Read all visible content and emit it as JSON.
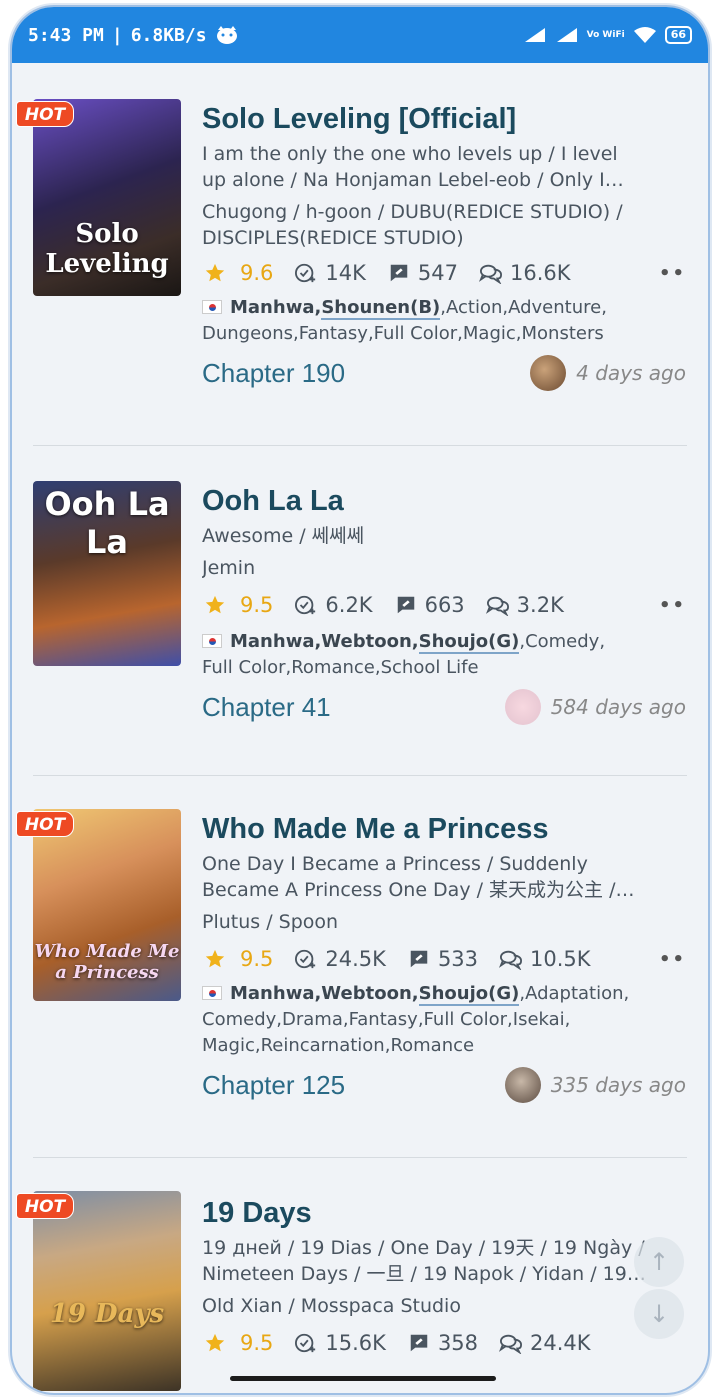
{
  "status_bar": {
    "time": "5:43 PM",
    "speed": "6.8KB/s",
    "wifi_label": "Vo WiFi",
    "battery": "66"
  },
  "comics": [
    {
      "hot": true,
      "hot_label": "HOT",
      "cover_text": "Solo Leveling",
      "title": "Solo Leveling [Official]",
      "alt_line1": "I am the only the one who levels up / I level",
      "alt_line2": "up alone / Na Honjaman Lebel-eob / Only I…",
      "authors_line1": "Chugong / h-goon / DUBU(REDICE STUDIO) /",
      "authors_line2": "DISCIPLES(REDICE STUDIO)",
      "rating": "9.6",
      "follows": "14K",
      "comments": "547",
      "reviews": "16.6K",
      "genre_primary": "Manhwa,",
      "genre_under": "Shounen(B)",
      "genre_rest1": ",Action,Adventure,",
      "genre_line2": "Dungeons,Fantasy,Full Color,Magic,Monsters",
      "chapter": "Chapter 190",
      "updated": "4 days ago"
    },
    {
      "hot": false,
      "cover_text": "Ooh La La",
      "title": "Ooh La La",
      "alt_line1": "Awesome / 쎄쎄쎄",
      "authors_line1": "Jemin",
      "rating": "9.5",
      "follows": "6.2K",
      "comments": "663",
      "reviews": "3.2K",
      "genre_primary": "Manhwa,Webtoon,",
      "genre_under": "Shoujo(G)",
      "genre_rest1": ",Comedy,",
      "genre_line2": "Full Color,Romance,School Life",
      "chapter": "Chapter 41",
      "updated": "584 days ago"
    },
    {
      "hot": true,
      "hot_label": "HOT",
      "cover_text": "Who Made Me a Princess",
      "title": "Who Made Me a Princess",
      "alt_line1": "One Day I Became a Princess / Suddenly",
      "alt_line2": "Became A Princess One Day / 某天成为公主 /…",
      "authors_line1": "Plutus / Spoon",
      "rating": "9.5",
      "follows": "24.5K",
      "comments": "533",
      "reviews": "10.5K",
      "genre_primary": "Manhwa,Webtoon,",
      "genre_under": "Shoujo(G)",
      "genre_rest1": ",Adaptation,",
      "genre_line2": "Comedy,Drama,Fantasy,Full Color,Isekai,",
      "genre_line3": "Magic,Reincarnation,Romance",
      "chapter": "Chapter 125",
      "updated": "335 days ago"
    },
    {
      "hot": true,
      "hot_label": "HOT",
      "cover_text": "19 Days",
      "title": "19 Days",
      "alt_line1": "19 дней / 19 Dias / One Day / 19天 / 19 Ngày /",
      "alt_line2": "Nimeteen Days / 一旦 / 19 Napok / Yidan / 19…",
      "authors_line1": "Old Xian / Mosspaca Studio",
      "rating": "9.5",
      "follows": "15.6K",
      "comments": "358",
      "reviews": "24.4K"
    }
  ],
  "colors": {
    "status_bar": "#2186e0",
    "hot": "#ee4a24",
    "title": "#1b4a5e",
    "chapter": "#2a6a86",
    "star": "#f0b21b"
  }
}
